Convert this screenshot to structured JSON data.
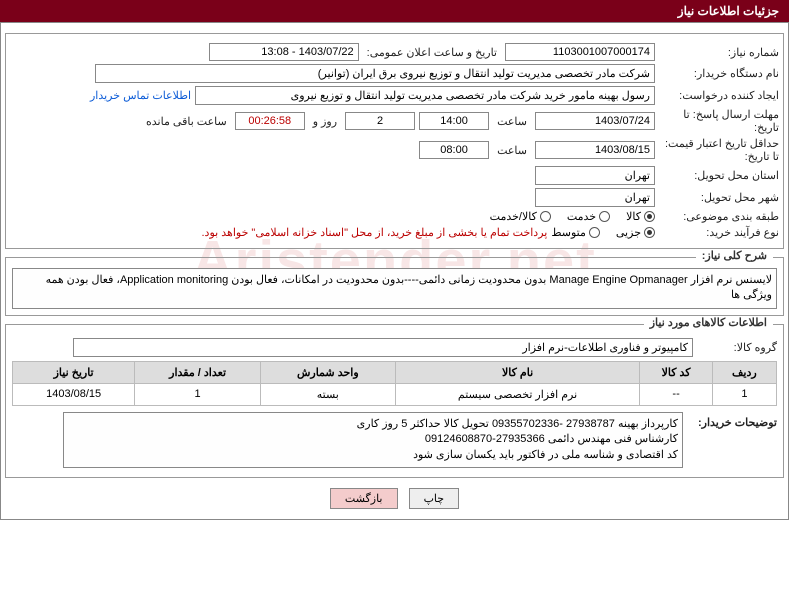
{
  "header_title": "جزئیات اطلاعات نیاز",
  "labels": {
    "need_no": "شماره نیاز:",
    "announce_dt": "تاریخ و ساعت اعلان عمومی:",
    "buyer_org": "نام دستگاه خریدار:",
    "requester": "ایجاد کننده درخواست:",
    "contact": "اطلاعات تماس خریدار",
    "reply_deadline": "مهلت ارسال پاسخ: تا تاریخ:",
    "hour": "ساعت",
    "day_and": "روز و",
    "remaining": "ساعت باقی مانده",
    "price_validity": "حداقل تاریخ اعتبار قیمت: تا تاریخ:",
    "delivery_prov": "استان محل تحویل:",
    "delivery_city": "شهر محل تحویل:",
    "subject_class": "طبقه بندی موضوعی:",
    "purchase_proc": "نوع فرآیند خرید:",
    "fs_desc": "شرح کلی نیاز:",
    "fs_items": "اطلاعات کالاهای مورد نیاز",
    "goods_group": "گروه کالا:",
    "buyer_notes": "توضیحات خریدار:",
    "btn_print": "چاپ",
    "btn_back": "بازگشت"
  },
  "fields": {
    "need_no": "1103001007000174",
    "announce_dt": "1403/07/22 - 13:08",
    "buyer_org": "شرکت مادر تخصصی مدیریت تولید انتقال و توزیع نیروی برق ایران (توانیر)",
    "requester": "رسول بهینه مامور خرید شرکت مادر تخصصی مدیریت تولید انتقال و توزیع نیروی",
    "reply_date": "1403/07/24",
    "reply_time": "14:00",
    "remain_days": "2",
    "remain_time": "00:26:58",
    "valid_date": "1403/08/15",
    "valid_time": "08:00",
    "delivery_prov": "تهران",
    "delivery_city": "تهران",
    "goods_group": "کامپیوتر و فناوری اطلاعات-نرم افزار"
  },
  "subject_options": [
    "کالا",
    "خدمت",
    "کالا/خدمت"
  ],
  "subject_selected": "کالا",
  "proc_options": [
    "جزیی",
    "متوسط"
  ],
  "proc_selected": "جزیی",
  "proc_note": "پرداخت تمام یا بخشی از مبلغ خرید، از محل \"اسناد خزانه اسلامی\" خواهد بود.",
  "need_desc": "لایسنس نرم افزار Manage Engine Opmanager بدون محدودیت زمانی دائمی----بدون محدودیت در امکانات، فعال بودن Application monitoring، فعال بودن همه ویژگی ها",
  "buyer_notes": "کارپرداز بهینه 27938787 -09355702336         تحویل کالا حداکثر 5 روز کاری\nکارشناس فنی مهندس دائمی 27935366-09124608870\nکد اقتصادی و شناسه ملی در فاکتور باید یکسان سازی شود",
  "table": {
    "headers": [
      "ردیف",
      "کد کالا",
      "نام کالا",
      "واحد شمارش",
      "تعداد / مقدار",
      "تاریخ نیاز"
    ],
    "rows": [
      {
        "c": [
          "1",
          "--",
          "نرم افزار تخصصی سیستم",
          "بسته",
          "1",
          "1403/08/15"
        ]
      }
    ]
  },
  "watermark": "Aristender.net"
}
